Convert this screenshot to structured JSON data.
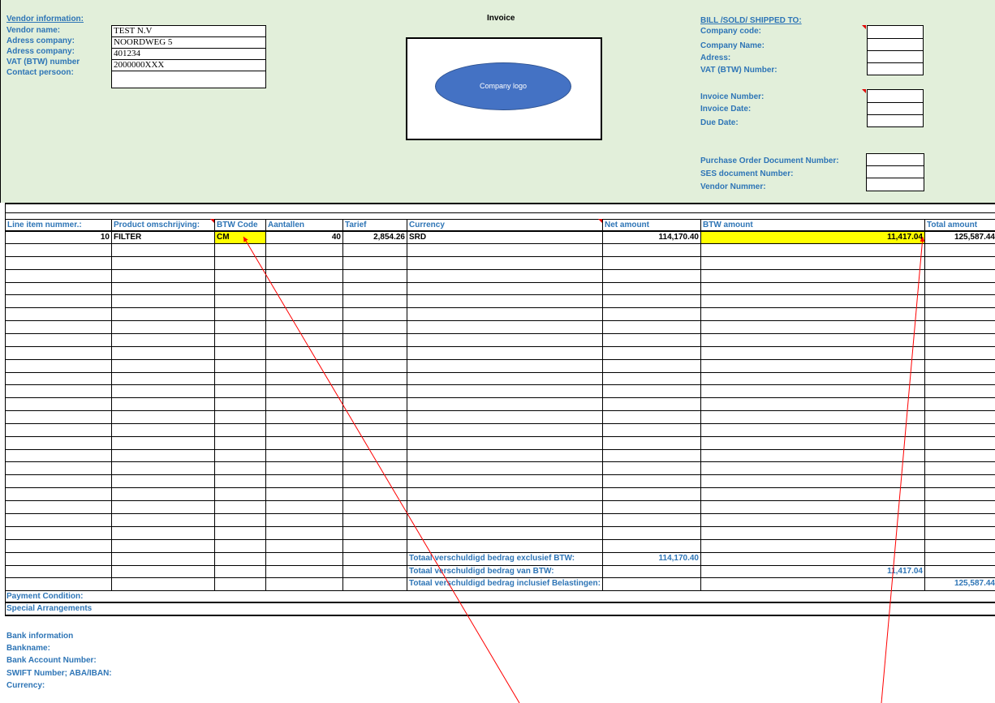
{
  "header": {
    "invoice_title": "Invoice",
    "logo_text": "Company logo"
  },
  "vendor": {
    "section_title": "Vendor information:",
    "fields": [
      {
        "label": "Vendor name:",
        "value": "TEST N.V"
      },
      {
        "label": "Adress company:",
        "value": "NOORDWEG 5"
      },
      {
        "label": "Adress company:",
        "value": "401234"
      },
      {
        "label": "VAT (BTW) number",
        "value": "2000000XXX"
      },
      {
        "label": "Contact persoon:",
        "value": ""
      }
    ]
  },
  "billing": {
    "section_title": "BILL /SOLD/ SHIPPED TO:",
    "company_fields": [
      {
        "label": "Company code:",
        "value": ""
      },
      {
        "label": "Company Name:",
        "value": ""
      },
      {
        "label": "Adress:",
        "value": ""
      },
      {
        "label": "VAT (BTW) Number:",
        "value": ""
      }
    ],
    "invoice_fields": [
      {
        "label": "Invoice Number:",
        "value": ""
      },
      {
        "label": "Invoice Date:",
        "value": ""
      },
      {
        "label": "Due Date:",
        "value": ""
      }
    ],
    "order_fields": [
      {
        "label": "Purchase Order Document Number:",
        "value": ""
      },
      {
        "label": "SES document Number:",
        "value": ""
      },
      {
        "label": "Vendor Nummer:",
        "value": ""
      }
    ]
  },
  "table": {
    "columns": [
      "Line item nummer.:",
      "Product omschrijving:",
      "BTW Code",
      "Aantallen",
      "Tarief",
      "Currency",
      "Net amount",
      "BTW amount",
      "Total amount"
    ],
    "rows": [
      {
        "line": "10",
        "product": "FILTER",
        "btw_code": "CM",
        "qty": "40",
        "rate": "2,854.26",
        "currency": "SRD",
        "net": "114,170.40",
        "btw": "11,417.04",
        "total": "125,587.44"
      }
    ],
    "highlight_color": "#ffff00"
  },
  "totals": {
    "excl_label": "Totaal verschuldigd bedrag exclusief BTW:",
    "excl_value": "114,170.40",
    "btw_label": "Totaal verschuldigd bedrag van BTW:",
    "btw_value": "11,417.04",
    "incl_label": "Totaal verschuldigd bedrag inclusief Belastingen:",
    "incl_value": "125,587.44"
  },
  "footer": {
    "payment_condition": "Payment Condition:",
    "special_arrangements": "Special Arrangements",
    "bank_title": "Bank information",
    "bank_fields": [
      "Bankname:",
      "Bank Account Number:",
      "SWIFT Number; ABA/IBAN:",
      "Currency:"
    ]
  },
  "colors": {
    "header_bg": "#e2efda",
    "label_blue": "#2e75b6",
    "logo_fill": "#4472c4",
    "arrow_red": "#ff0000"
  }
}
